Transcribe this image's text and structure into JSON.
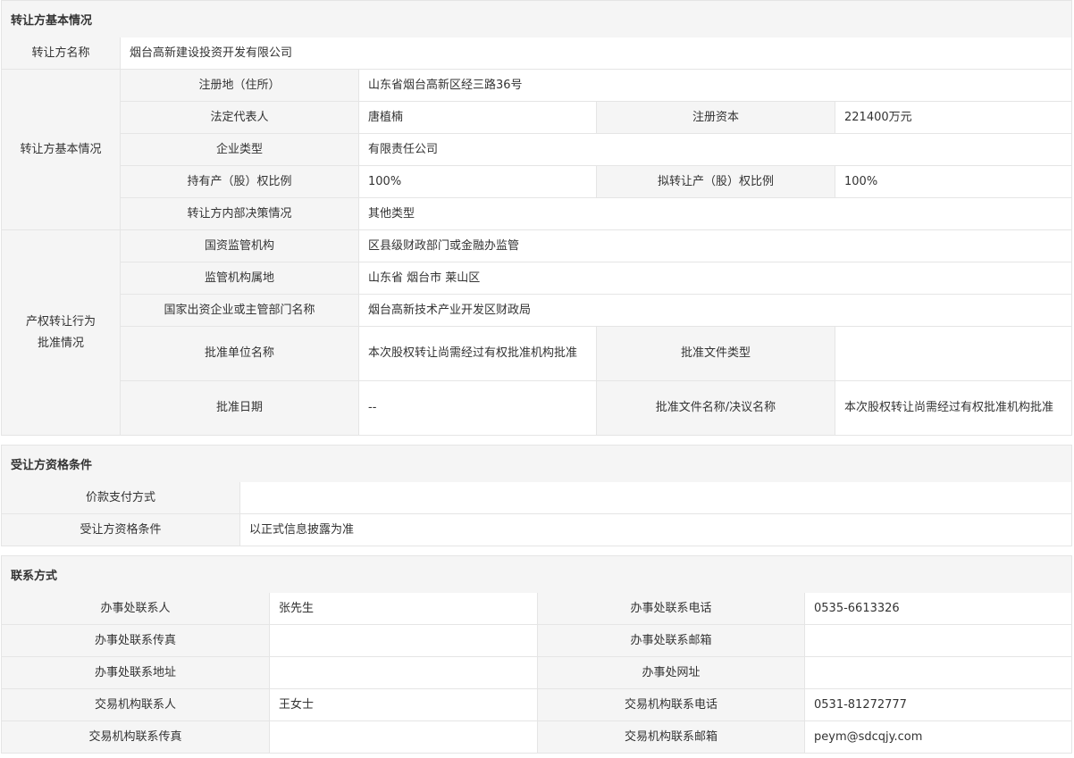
{
  "section1": {
    "title": "转让方基本情况",
    "name_label": "转让方名称",
    "name_value": "烟台高新建设投资开发有限公司",
    "group1_label": "转让方基本情况",
    "reg_address_label": "注册地（住所）",
    "reg_address_value": "山东省烟台高新区经三路36号",
    "legal_rep_label": "法定代表人",
    "legal_rep_value": "唐植楠",
    "reg_capital_label": "注册资本",
    "reg_capital_value": "221400万元",
    "company_type_label": "企业类型",
    "company_type_value": "有限责任公司",
    "hold_ratio_label": "持有产（股）权比例",
    "hold_ratio_value": "100%",
    "transfer_ratio_label": "拟转让产（股）权比例",
    "transfer_ratio_value": "100%",
    "decision_label": "转让方内部决策情况",
    "decision_value": "其他类型",
    "group2_label": "产权转让行为批准情况",
    "regulator_label": "国资监管机构",
    "regulator_value": "区县级财政部门或金融办监管",
    "regulator_location_label": "监管机构属地",
    "regulator_location_value": "山东省 烟台市 莱山区",
    "state_enterprise_label": "国家出资企业或主管部门名称",
    "state_enterprise_value": "烟台高新技术产业开发区财政局",
    "approval_unit_label": "批准单位名称",
    "approval_unit_value": "本次股权转让尚需经过有权批准机构批准",
    "approval_doc_type_label": "批准文件类型",
    "approval_doc_type_value": "",
    "approval_date_label": "批准日期",
    "approval_date_value": "--",
    "approval_doc_name_label": "批准文件名称/决议名称",
    "approval_doc_name_value": "本次股权转让尚需经过有权批准机构批准"
  },
  "section2": {
    "title": "受让方资格条件",
    "payment_label": "价款支付方式",
    "payment_value": "",
    "qualification_label": "受让方资格条件",
    "qualification_value": "以正式信息披露为准"
  },
  "section3": {
    "title": "联系方式",
    "rows": [
      {
        "label1": "办事处联系人",
        "value1": "张先生",
        "label2": "办事处联系电话",
        "value2": "0535-6613326"
      },
      {
        "label1": "办事处联系传真",
        "value1": "",
        "label2": "办事处联系邮箱",
        "value2": ""
      },
      {
        "label1": "办事处联系地址",
        "value1": "",
        "label2": "办事处网址",
        "value2": ""
      },
      {
        "label1": "交易机构联系人",
        "value1": "王女士",
        "label2": "交易机构联系电话",
        "value2": "0531-81272777"
      },
      {
        "label1": "交易机构联系传真",
        "value1": "",
        "label2": "交易机构联系邮箱",
        "value2": "peym@sdcqjy.com"
      }
    ]
  },
  "colors": {
    "label_bg": "#f5f5f5",
    "border": "#e5e5e5",
    "text": "#333333"
  }
}
